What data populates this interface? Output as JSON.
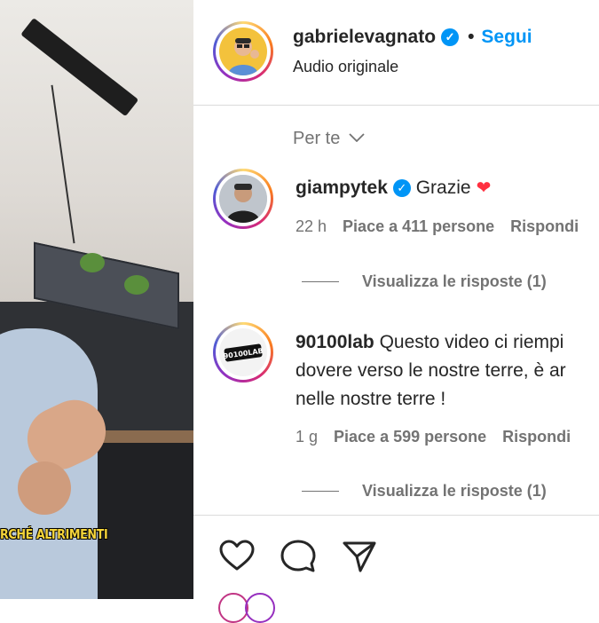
{
  "video": {
    "caption": "RCHÉ ALTRIMENTI"
  },
  "post": {
    "author": "gabrielevagnato",
    "separator": "•",
    "follow_label": "Segui",
    "audio_label": "Audio originale"
  },
  "sort": {
    "label": "Per te",
    "icon": "chevron-down-icon"
  },
  "comments": [
    {
      "username": "giampytek",
      "verified": true,
      "text": "Grazie",
      "emoji": "❤",
      "time": "22 h",
      "likes": "Piace a 411 persone",
      "reply": "Rispondi",
      "view_replies": "Visualizza le risposte (1)"
    },
    {
      "username": "90100lab",
      "verified": false,
      "text_lines": [
        "Questo video ci riempi",
        "dovere verso le nostre terre, è ar",
        "nelle nostre terre !"
      ],
      "avatar_text": "90100LAB",
      "time": "1 g",
      "likes": "Piace a 599 persone",
      "reply": "Rispondi",
      "view_replies": "Visualizza le risposte (1)"
    }
  ],
  "actions": {
    "like": "heart-icon",
    "comment": "comment-icon",
    "share": "share-icon"
  },
  "colors": {
    "link_blue": "#0095f6",
    "verified_blue": "#0095f6",
    "text": "#262626",
    "secondary": "#737373",
    "heart": "#ff3040",
    "caption_yellow": "#f5d43a"
  }
}
